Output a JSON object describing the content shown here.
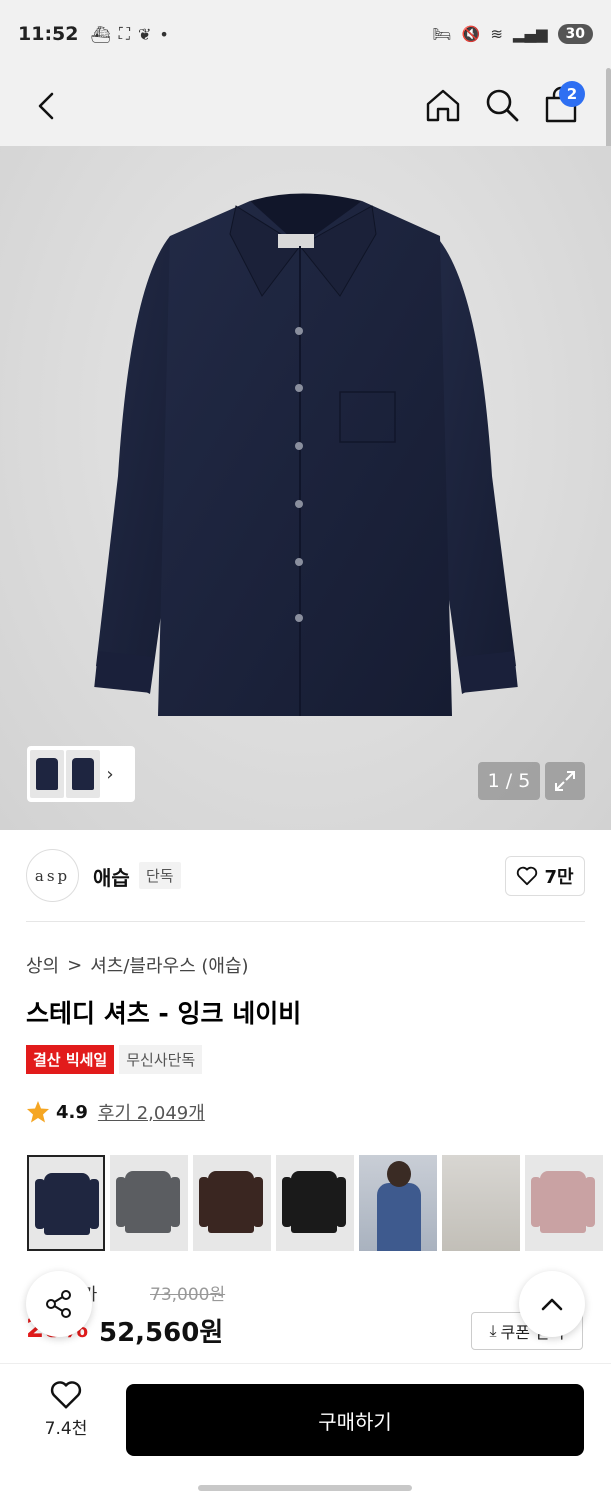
{
  "status_bar": {
    "time": "11:52",
    "battery": "30"
  },
  "nav": {
    "cart_count": "2"
  },
  "gallery": {
    "page_counter": "1 / 5"
  },
  "brand": {
    "logo_text": "asp",
    "name": "애습",
    "tag": "단독",
    "likes": "7만"
  },
  "breadcrumb": {
    "category": "상의",
    "separator": ">",
    "subcategory": "셔츠/블라우스 (애습)"
  },
  "product": {
    "title": "스테디 셔츠 - 잉크 네이비",
    "tags": [
      "결산 빅세일",
      "무신사단독"
    ],
    "rating": "4.9",
    "reviews_label": "후기 2,049개"
  },
  "color_options": [
    {
      "name": "navy",
      "color": "#1f2640",
      "type": "flat",
      "selected": true
    },
    {
      "name": "charcoal",
      "color": "#5b5d61",
      "type": "flat",
      "selected": false
    },
    {
      "name": "brown",
      "color": "#3a2621",
      "type": "flat",
      "selected": false
    },
    {
      "name": "black",
      "color": "#1a1a1a",
      "type": "flat",
      "selected": false
    },
    {
      "name": "model-blue",
      "color": "#3e5a8e",
      "type": "photo",
      "selected": false
    },
    {
      "name": "model-white",
      "color": "#ececec",
      "type": "photo2",
      "selected": false
    },
    {
      "name": "pink",
      "color": "#c9a2a3",
      "type": "flat",
      "selected": false
    }
  ],
  "price": {
    "label": "정가",
    "original": "73,000원",
    "discount": "28%",
    "final": "52,560원",
    "coupon_label": "쿠폰 받기"
  },
  "bottom": {
    "likes": "7.4천",
    "buy_label": "구매하기"
  },
  "colors": {
    "accent_red": "#e21b1b",
    "badge_blue": "#2e6ff2",
    "star": "#f5a623"
  }
}
